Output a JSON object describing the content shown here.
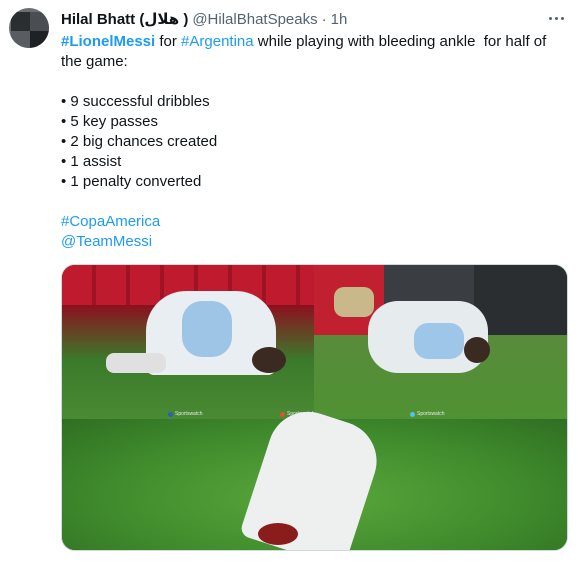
{
  "tweet": {
    "author_name": "Hilal Bhatt (هلال )",
    "author_handle": "@HilalBhatSpeaks",
    "separator": "·",
    "time": "1h",
    "text": {
      "hashtag_messi": "#LionelMessi",
      "text_for": " for ",
      "hashtag_argentina": "#Argentina",
      "text_rest": " while playing with bleeding ankle  for half of",
      "text_line2": "the game:",
      "stats": [
        "• 9 successful dribbles",
        "• 5 key passes",
        "• 2 big chances created",
        "• 1 assist",
        "• 1 penalty converted"
      ],
      "hashtag_copa": "#CopaAmerica",
      "mention_team": "@TeamMessi"
    },
    "media": {
      "watermarks": [
        "Sportswatch",
        "Sportswatch",
        "Sportswatch"
      ]
    }
  },
  "colors": {
    "link": "#1d9bf0",
    "text": "#0f1419",
    "muted": "#536471",
    "pitch": "#3f7f2e"
  },
  "icons": {
    "more": "more-horizontal-icon"
  }
}
